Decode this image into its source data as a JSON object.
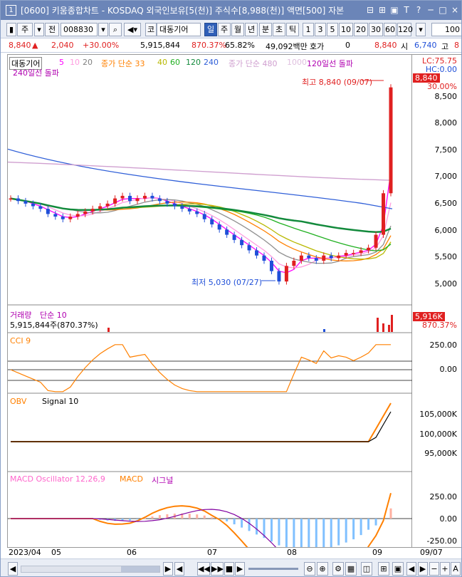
{
  "window": {
    "number": "1",
    "title": "[0600] 키움종합차트 - KOSDAQ 외국인보유[5(천)] 주식수[8,988(천)] 액면[500] 자본",
    "title_buttons": [
      "⊟",
      "⊞",
      "▣",
      "T",
      "?",
      "─",
      "□",
      "×"
    ]
  },
  "toolbar": {
    "item_mode": "주",
    "mode_btn": "전",
    "code": "008830",
    "search_icon": "🔍",
    "name_prefix": "코",
    "stock_name": "대동기어",
    "periods": [
      "일",
      "주",
      "월",
      "년",
      "분",
      "초",
      "틱"
    ],
    "active_period": "일",
    "intervals": [
      "1",
      "3",
      "5",
      "10",
      "20",
      "30",
      "60",
      "120"
    ],
    "count": "100"
  },
  "info": {
    "price": "8,840",
    "arrow": "▲",
    "change": "2,040",
    "change_pct": "+30.00%",
    "volume": "5,915,844",
    "vol_ratio": "870.37%",
    "turnover": "65.82%",
    "amount": "49,092백만",
    "hoga_label": "호가",
    "hoga": "0",
    "current": "8,840",
    "open_label": "시",
    "open": "6,740",
    "high_label": "고",
    "high": "8"
  },
  "colors": {
    "up": "#e02020",
    "down": "#1f4fd8",
    "ma5": "#ff00ff",
    "ma10": "#ff9de0",
    "ma20": "#909090",
    "ma33": "#ff8000",
    "ma40": "#b8b800",
    "ma60": "#20b020",
    "ma120": "#138a3c",
    "ma240": "#2f5fd8",
    "ma480": "#d0a0d0"
  },
  "price_legend": {
    "name": "대동기어",
    "ma_labels": [
      "5",
      "10",
      "20"
    ],
    "ma2_label": "종가 단순 33",
    "ma2_values": [
      "40",
      "60",
      "120",
      "240"
    ],
    "ma3_label": "종가 단순 480",
    "ma3_value": "1000",
    "line_label": "120일선 돌파",
    "line2_label": "240일선 돌파"
  },
  "annotations": {
    "high": "최고 8,840 (09/07)",
    "low": "최저 5,030 (07/27)"
  },
  "price_axis": {
    "lc": "LC:75.75",
    "hc": "HC:0.00",
    "current": "8,840",
    "pct": "30.00%",
    "ticks": [
      "8,500",
      "8,000",
      "7,500",
      "7,000",
      "6,500",
      "6,000",
      "5,500",
      "5,000"
    ]
  },
  "volume_legend": {
    "name": "거래량",
    "ma": "단순 10",
    "value": "5,915,844주(870.37%)",
    "tag": "5,916K",
    "tag_pct": "870.37%"
  },
  "cci": {
    "label": "CCI 9",
    "ticks": [
      "250.00",
      "0.00"
    ]
  },
  "obv": {
    "label": "OBV",
    "signal": "Signal 10",
    "ticks": [
      "105,000K",
      "100,000K",
      "95,000K"
    ]
  },
  "macd": {
    "label": "MACD Oscillator 12,26,9",
    "macd": "MACD",
    "signal": "시그널",
    "ticks": [
      "250.00",
      "0.00",
      "-250.00"
    ]
  },
  "dates": [
    "2023/04",
    "05",
    "06",
    "07",
    "08",
    "09",
    "09/07"
  ],
  "bottom": {
    "buttons": [
      "◀",
      "◀◀",
      "▶▶",
      "■",
      "▶",
      "◀",
      "▶",
      "▶"
    ]
  },
  "chart_data": [
    {
      "type": "candlestick",
      "title": "대동기어",
      "ylim": [
        4800,
        9000
      ],
      "close_series": [
        6700,
        6650,
        6600,
        6550,
        6500,
        6400,
        6350,
        6300,
        6350,
        6400,
        6450,
        6500,
        6550,
        6600,
        6700,
        6750,
        6650,
        6700,
        6750,
        6700,
        6650,
        6600,
        6550,
        6500,
        6450,
        6400,
        6300,
        6200,
        6100,
        6000,
        5900,
        5800,
        5700,
        5600,
        5500,
        5300,
        5100,
        5400,
        5500,
        5600,
        5550,
        5500,
        5600,
        5550,
        5600,
        5650,
        5650,
        5700,
        5750,
        6000,
        6800,
        8840
      ],
      "low": 5030,
      "low_date": "07/27",
      "high": 8840,
      "high_date": "09/07"
    },
    {
      "type": "bar",
      "title": "거래량",
      "last_volume": 5915844
    },
    {
      "type": "line",
      "title": "CCI 9",
      "ylim": [
        -300,
        350
      ]
    },
    {
      "type": "line",
      "title": "OBV",
      "ylim": [
        90000,
        110000
      ]
    },
    {
      "type": "bar",
      "title": "MACD Oscillator 12,26,9",
      "ylim": [
        -300,
        400
      ]
    }
  ]
}
